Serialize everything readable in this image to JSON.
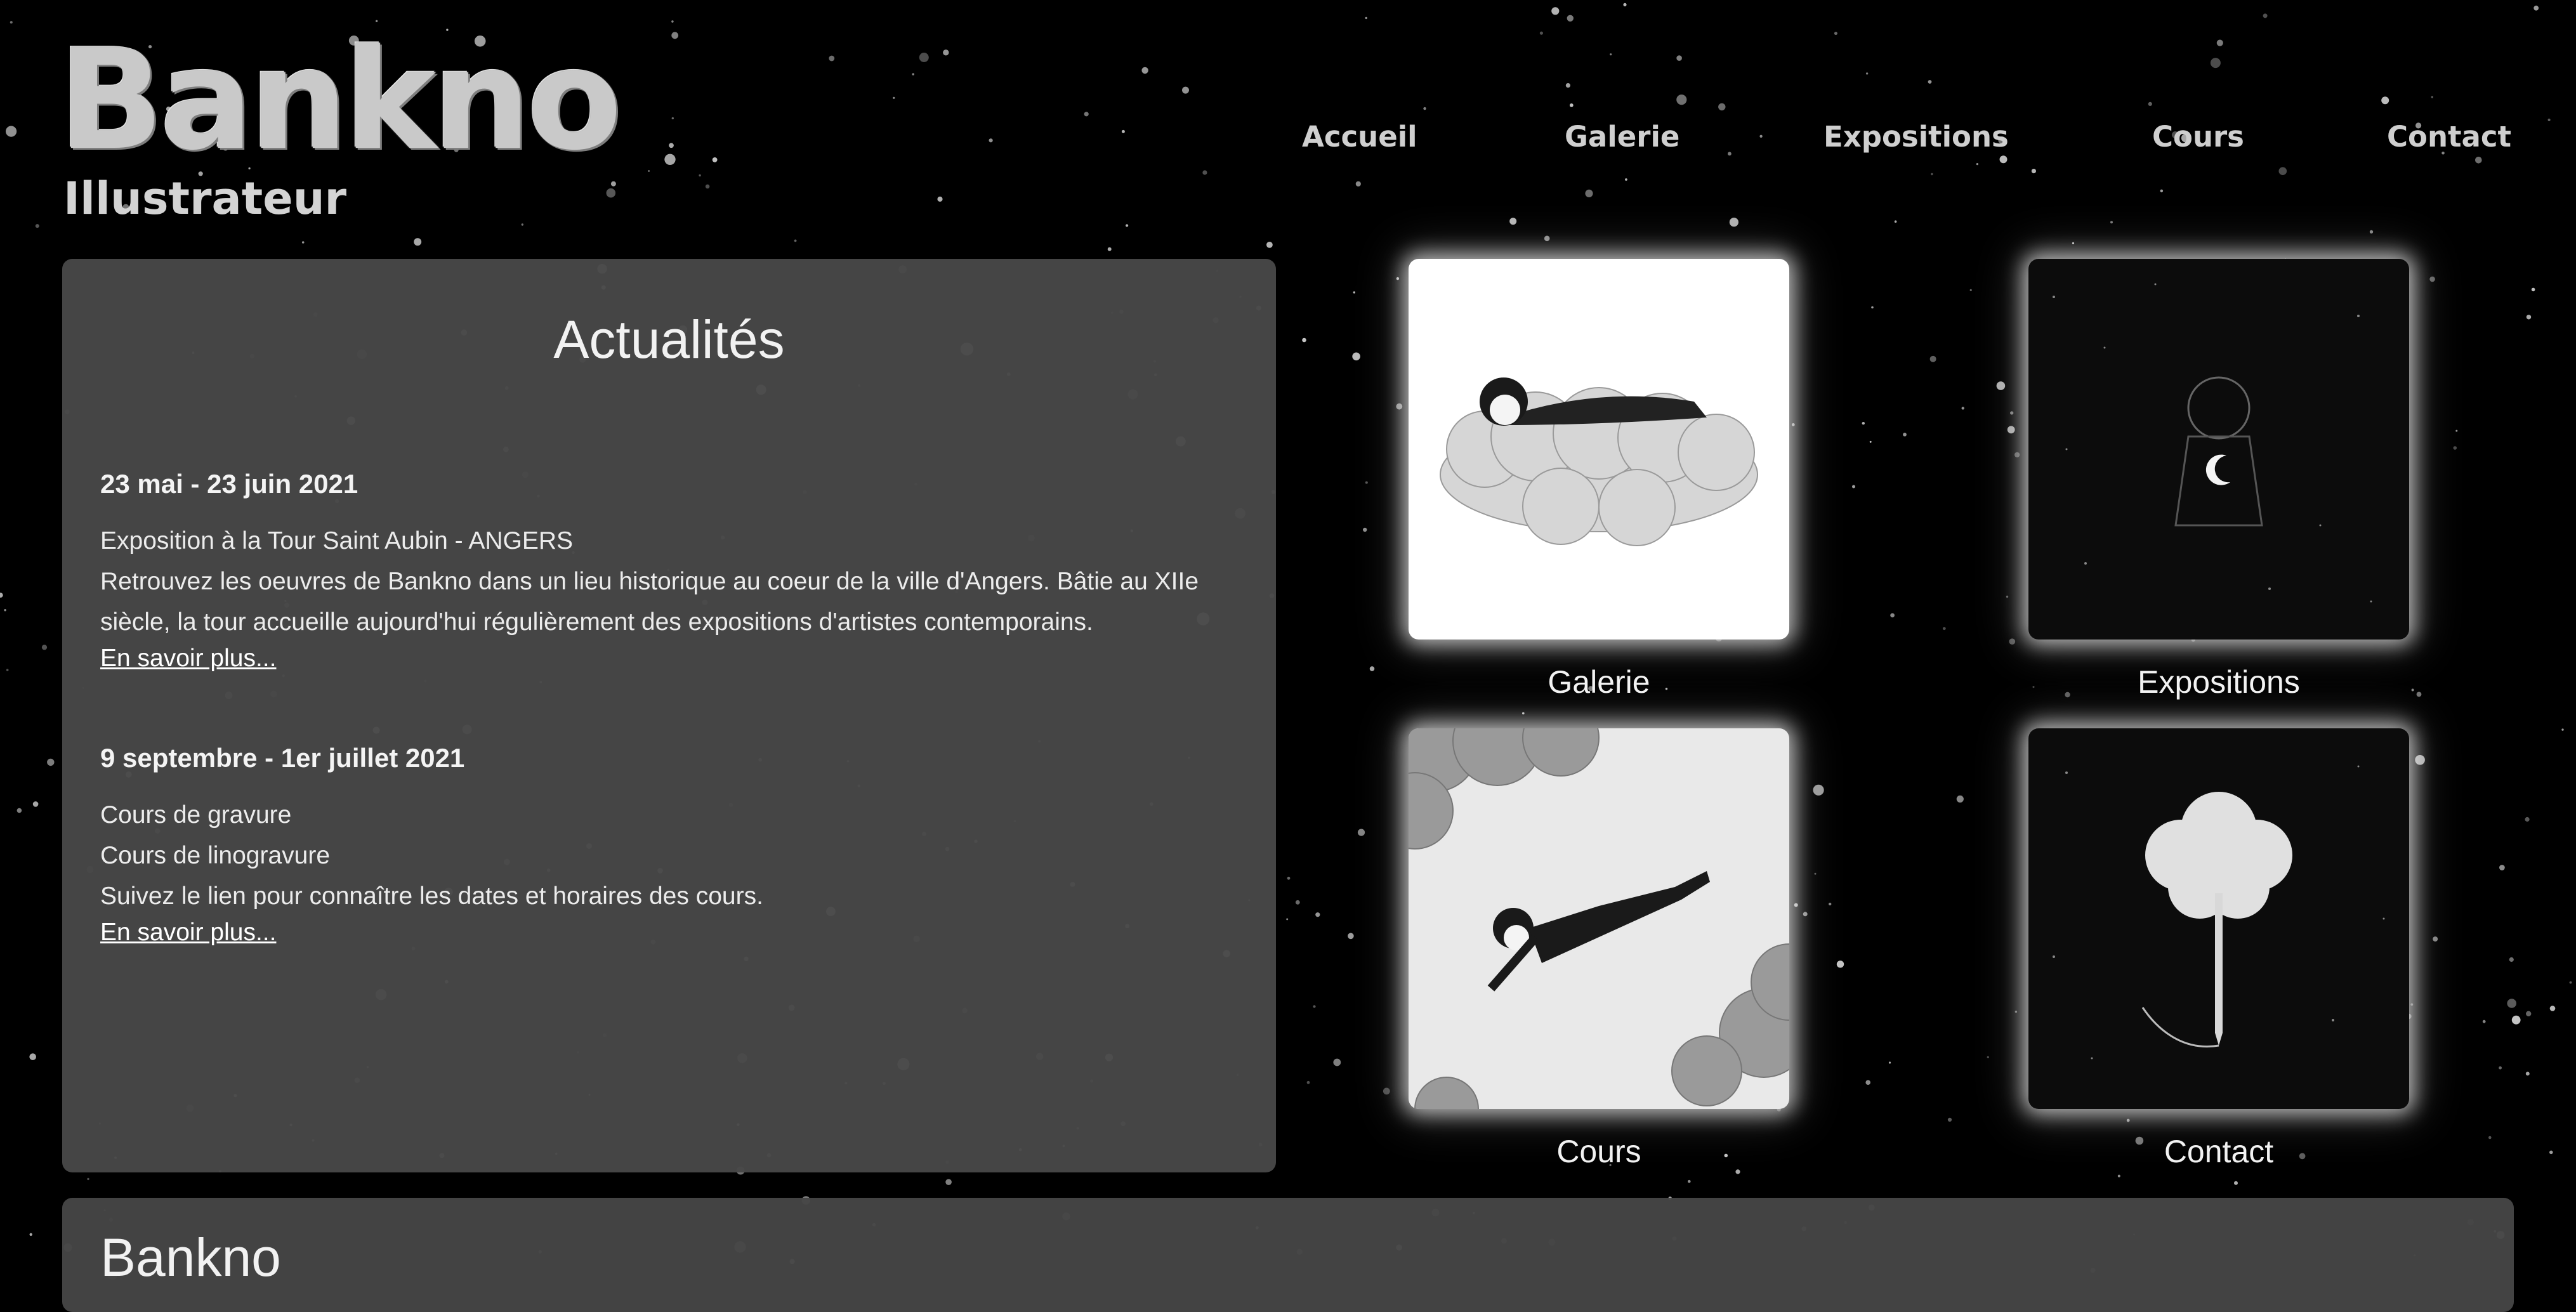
{
  "header": {
    "logo": "Bankno",
    "subtitle": "Illustrateur"
  },
  "nav": [
    {
      "label": "Accueil"
    },
    {
      "label": "Galerie"
    },
    {
      "label": "Expositions"
    },
    {
      "label": "Cours"
    },
    {
      "label": "Contact"
    }
  ],
  "news": {
    "title": "Actualités",
    "items": [
      {
        "date": "23 mai - 23 juin 2021",
        "lines": [
          "Exposition à la Tour Saint Aubin - ANGERS",
          "Retrouvez les oeuvres de Bankno dans un lieu historique au coeur de la ville d'Angers. Bâtie au XIIe",
          "siècle, la tour accueille aujourd'hui régulièrement des expositions d'artistes contemporains."
        ],
        "link": "En savoir plus..."
      },
      {
        "date": "9 septembre - 1er juillet 2021",
        "lines": [
          "Cours de gravure",
          "Cours de linogravure",
          "Suivez le lien pour connaître les dates et horaires des cours."
        ],
        "link": "En savoir plus..."
      }
    ]
  },
  "tiles": [
    {
      "label": "Galerie",
      "icon": "sleeping-on-cloud-illustration"
    },
    {
      "label": "Expositions",
      "icon": "child-holding-moon-illustration"
    },
    {
      "label": "Cours",
      "icon": "flying-boy-illustration"
    },
    {
      "label": "Contact",
      "icon": "pencil-tree-illustration"
    }
  ],
  "footer": {
    "title": "Bankno"
  },
  "colors": {
    "background": "#000000",
    "panel": "#484848",
    "text": "#f2f2f2",
    "nav": "#cfcfcf"
  }
}
